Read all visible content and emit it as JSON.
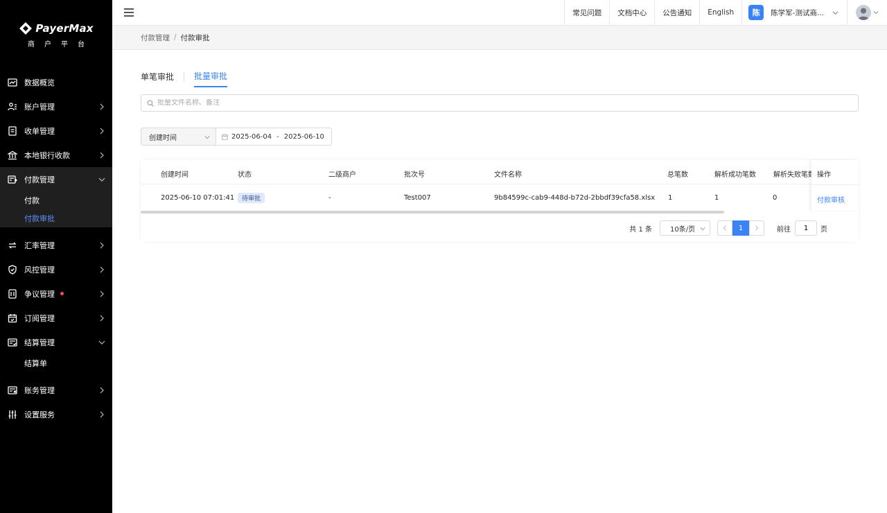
{
  "brand": {
    "name": "PayerMax",
    "subtitle": "商户平台"
  },
  "sidebar": {
    "items": [
      {
        "label": "数据概览",
        "icon": "chart-icon",
        "chevron": false
      },
      {
        "label": "账户管理",
        "icon": "users-icon",
        "chevron": true
      },
      {
        "label": "收单管理",
        "icon": "receipt-icon",
        "chevron": true
      },
      {
        "label": "本地银行收款",
        "icon": "bank-icon",
        "chevron": true
      },
      {
        "label": "付款管理",
        "icon": "payment-icon",
        "chevron": true,
        "expanded": true
      },
      {
        "label": "汇率管理",
        "icon": "exchange-icon",
        "chevron": true
      },
      {
        "label": "风控管理",
        "icon": "shield-icon",
        "chevron": true
      },
      {
        "label": "争议管理",
        "icon": "dispute-icon",
        "chevron": true,
        "badge_dot": true
      },
      {
        "label": "订阅管理",
        "icon": "calendar-icon",
        "chevron": true
      },
      {
        "label": "结算管理",
        "icon": "settlement-icon",
        "chevron": true,
        "expanded": true
      },
      {
        "label": "账务管理",
        "icon": "ledger-icon",
        "chevron": true
      },
      {
        "label": "设置服务",
        "icon": "settings-sliders-icon",
        "chevron": true
      }
    ],
    "payment_subitems": [
      {
        "label": "付款",
        "active": false
      },
      {
        "label": "付款审批",
        "active": true
      }
    ],
    "settlement_subitems": [
      {
        "label": "结算单"
      }
    ]
  },
  "header": {
    "links": [
      "常见问题",
      "文档中心",
      "公告通知",
      "English"
    ],
    "user_initial": "陈",
    "user_name": "陈学军-测试商..."
  },
  "breadcrumb": {
    "parent": "付款管理",
    "separator": "/",
    "current": "付款审批"
  },
  "tabs": [
    {
      "label": "单笔审批",
      "active": false
    },
    {
      "label": "批量审批",
      "active": true
    }
  ],
  "search": {
    "placeholder": "批量文件名称、备注",
    "value": ""
  },
  "filter": {
    "type_selected": "创建时间",
    "date_start": "2025-06-04",
    "date_separator": "-",
    "date_end": "2025-06-10"
  },
  "table": {
    "columns": [
      "创建时间",
      "状态",
      "二级商户",
      "批次号",
      "文件名称",
      "总笔数",
      "解析成功笔数",
      "解析失败笔数",
      "操作"
    ],
    "rows": [
      {
        "created": "2025-06-10 07:01:41",
        "status": "待审批",
        "sub_merchant": "-",
        "batch_no": "Test007",
        "file_name": "9b84599c-cab9-448d-b72d-2bbdf39cfa58.xlsx",
        "total": "1",
        "success": "1",
        "failed": "0",
        "action": "付款审核"
      }
    ]
  },
  "pagination": {
    "total_text": "共 1 条",
    "page_size": "10条/页",
    "current_page": "1",
    "goto_label": "前往",
    "goto_value": "1",
    "page_unit": "页"
  },
  "colors": {
    "accent": "#3b82f6",
    "sidebar_bg": "#000000",
    "badge_dot": "#ff4d4f"
  }
}
